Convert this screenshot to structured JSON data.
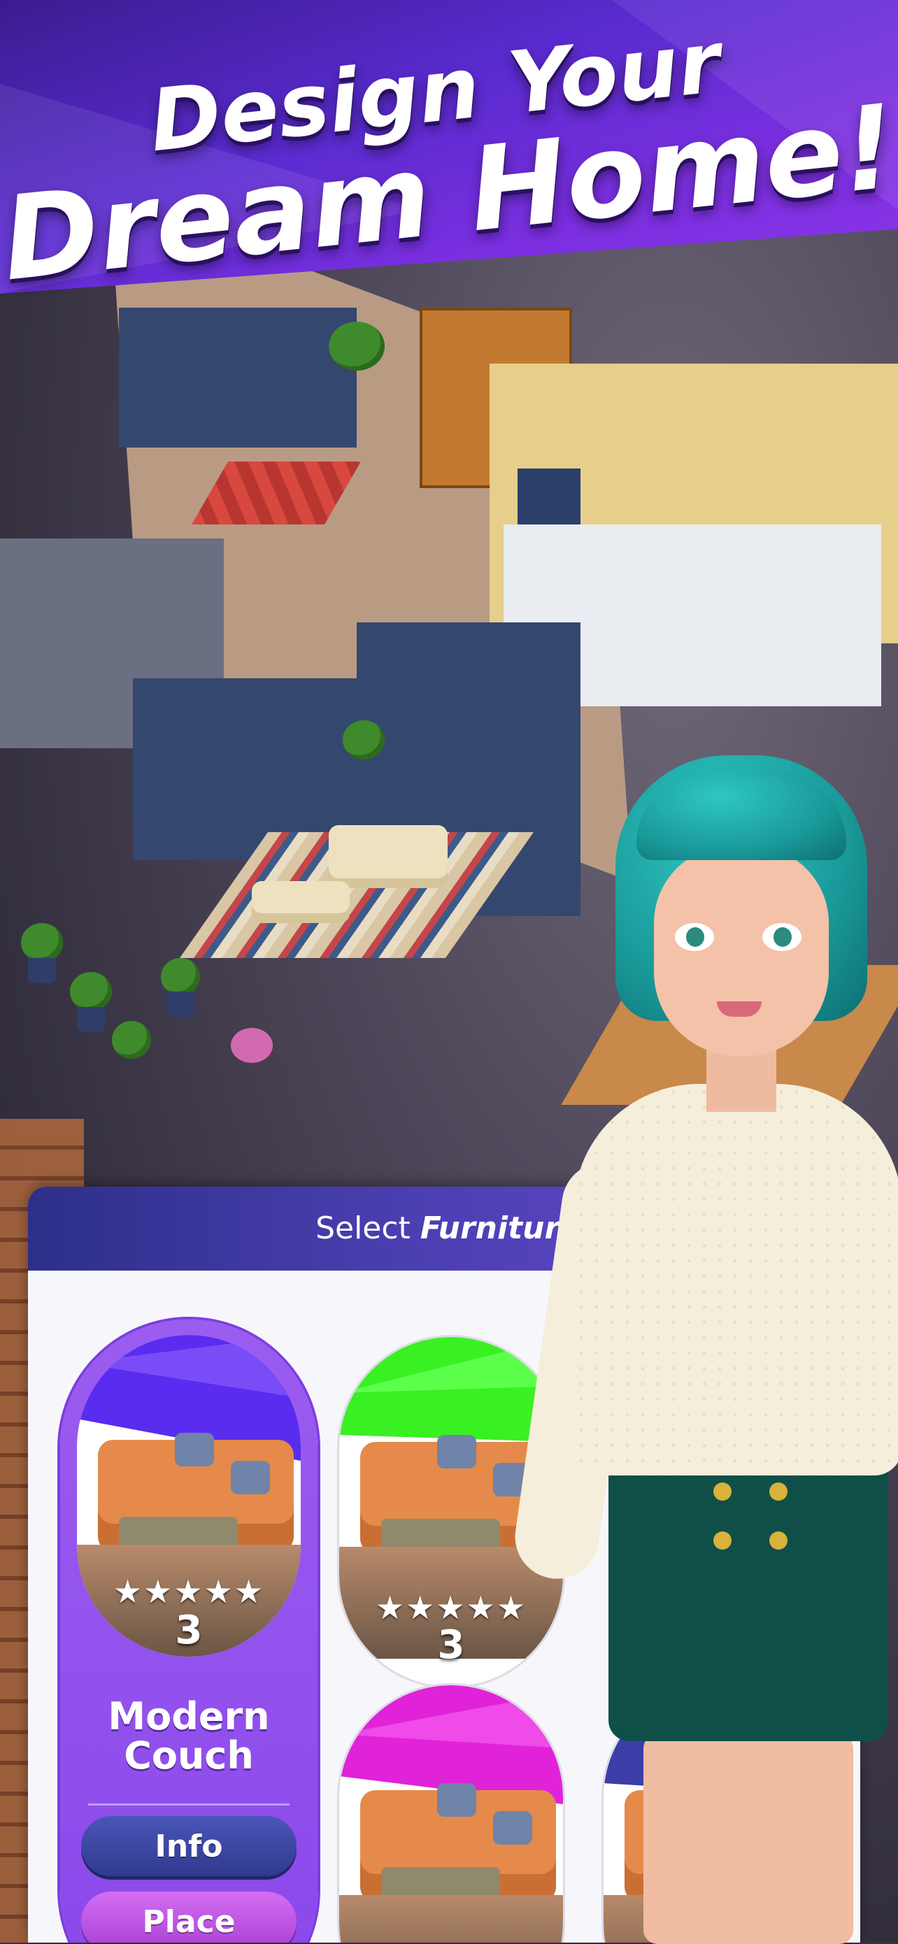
{
  "headline": {
    "line1": "Design Your",
    "line2": "Dream Home!"
  },
  "panel": {
    "title_prefix": "Select",
    "title_emphasis": "Furniture"
  },
  "items": [
    {
      "name_line1": "Modern",
      "name_line2": "Couch",
      "stars": "★★★★★",
      "count": "3",
      "accent": "#5a2cf0",
      "info_label": "Info",
      "place_label": "Place"
    },
    {
      "stars": "★★★★★",
      "count": "3",
      "accent": "#39f023"
    },
    {
      "stars": "★★★★★",
      "accent": "#e023d8"
    },
    {
      "stars": "★★★★★",
      "accent": "#3d3da8"
    }
  ],
  "icons": {
    "star": "star-icon"
  },
  "colors": {
    "banner": "#5a2bd0",
    "panel_header": "#2d2f8a",
    "selected_card": "#8a47ea",
    "info_button": "#2f3a8e",
    "place_button": "#a83fd6"
  }
}
